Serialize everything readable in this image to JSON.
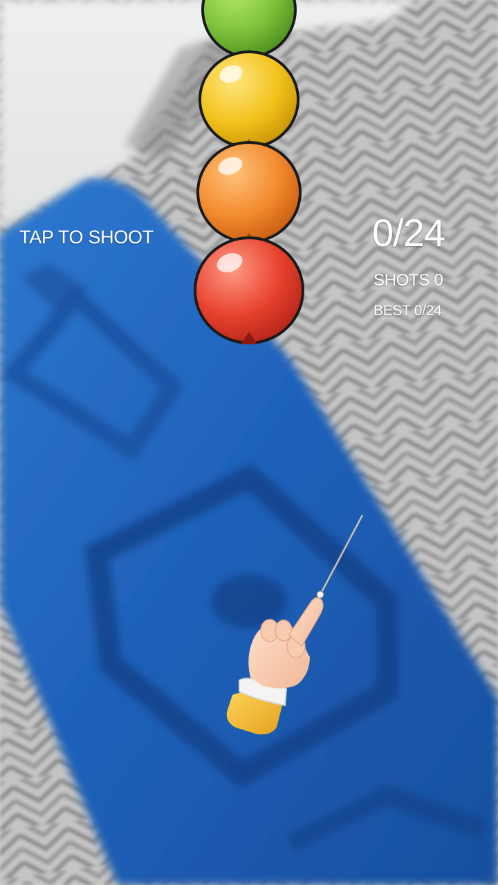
{
  "hud": {
    "hint": "TAP TO SHOOT",
    "score": "0/24",
    "shots": "SHOTS 0",
    "best": "BEST 0/24"
  },
  "colors": {
    "balloon_green": "#7cc13a",
    "balloon_yellow": "#f2c21c",
    "balloon_orange": "#f28a2e",
    "balloon_red": "#e7412d",
    "outline": "#1a1a1a",
    "background_blue": "#1c5fb8",
    "background_gray": "#c8c8c8",
    "sleeve": "#f3bd3c",
    "skin": "#f7cbb0"
  },
  "balloons": [
    {
      "color": "green"
    },
    {
      "color": "yellow"
    },
    {
      "color": "orange"
    },
    {
      "color": "red"
    }
  ],
  "icons": [
    "hand-pointer-icon",
    "needle-icon"
  ]
}
